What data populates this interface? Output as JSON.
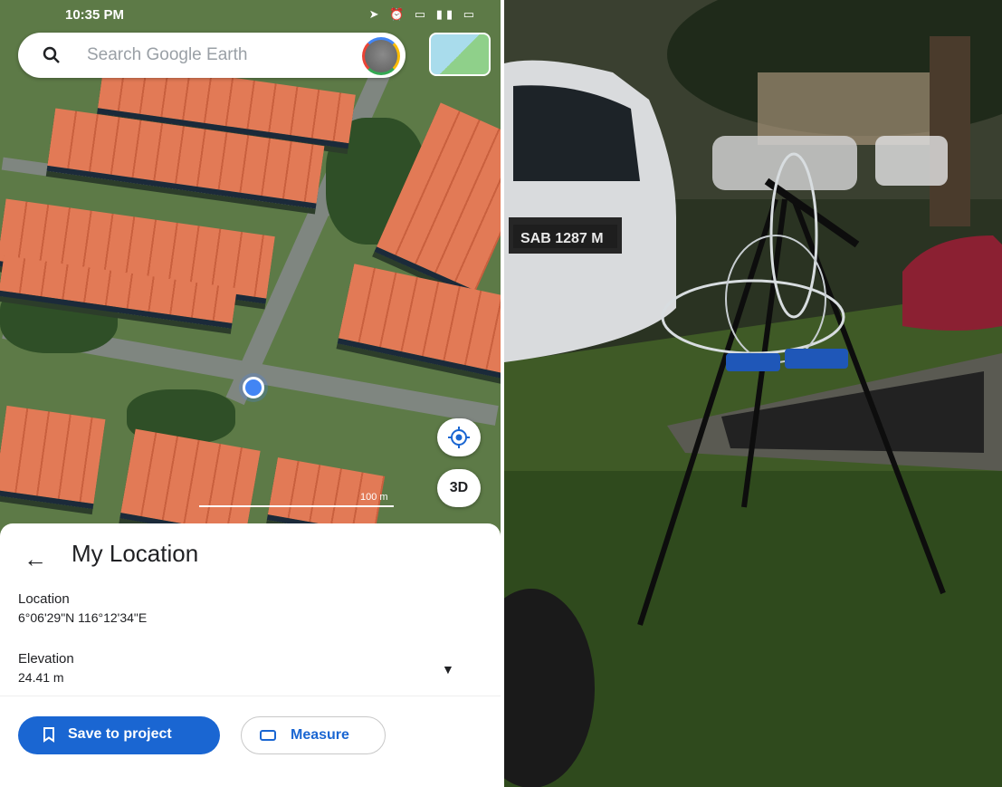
{
  "status_bar": {
    "time": "10:35 PM",
    "icons": "➤ ⏰ ▭ ▮▮ ▭"
  },
  "search": {
    "placeholder": "Search Google Earth"
  },
  "map": {
    "three_d_label": "3D",
    "scale_label": "100 m"
  },
  "panel": {
    "title": "My Location",
    "location_label": "Location",
    "location_value": "6°06'29\"N 116°12'34\"E",
    "elevation_label": "Elevation",
    "elevation_value": "24.41 m"
  },
  "actions": {
    "save_label": "Save to project",
    "measure_label": "Measure"
  },
  "photo": {
    "license_plate": "SAB 1287 M"
  },
  "colors": {
    "accent": "#1a66d2",
    "location_dot": "#4285f4",
    "roof": "#e27a56"
  }
}
